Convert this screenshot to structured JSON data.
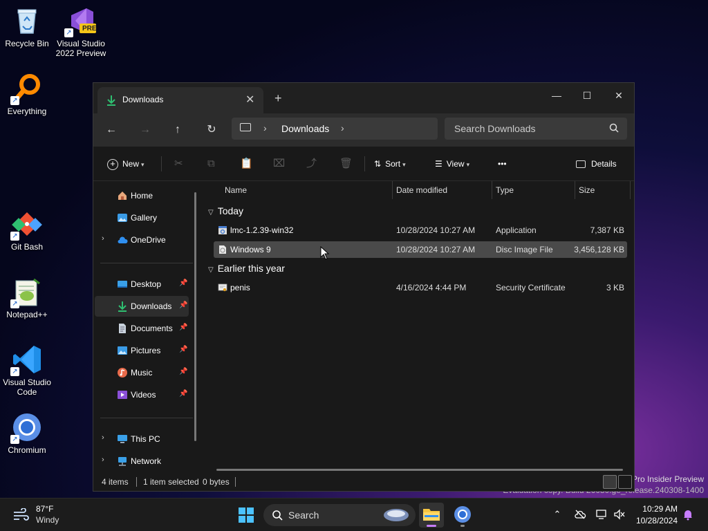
{
  "desktop": {
    "icons": [
      {
        "label": "Recycle Bin"
      },
      {
        "label": "Visual Studio 2022 Preview",
        "badge": "PRE"
      },
      {
        "label": "Everything"
      },
      {
        "label": "Git Bash"
      },
      {
        "label": "Notepad++"
      },
      {
        "label": "Visual Studio Code"
      },
      {
        "label": "Chromium"
      }
    ],
    "watermark_line1": "Pro Insider Preview",
    "watermark_line2": "Evaluation copy. Build 26080.ge_release.240308-1400"
  },
  "explorer": {
    "tab_title": "Downloads",
    "tab_close": "✕",
    "new_tab": "+",
    "window_controls": {
      "minimize": "—",
      "maximize": "☐",
      "close": "✕"
    },
    "nav": {
      "back": "←",
      "forward": "→",
      "up": "↑",
      "refresh": "↻"
    },
    "breadcrumb": {
      "separator": "›",
      "current": "Downloads"
    },
    "search_placeholder": "Search Downloads",
    "commands": {
      "new_label": "New",
      "sort_label": "Sort",
      "view_label": "View",
      "more_label": "•••",
      "details_label": "Details",
      "cut": "✂",
      "copy": "⧉",
      "paste": "📋",
      "rename": "⌧",
      "share": "⤴",
      "delete": "🗑"
    },
    "sidebar": {
      "items": [
        {
          "label": "Home",
          "pinned": false
        },
        {
          "label": "Gallery",
          "pinned": false
        },
        {
          "label": "OneDrive",
          "pinned": false,
          "expand": "›"
        },
        {
          "label": "Desktop",
          "pinned": true
        },
        {
          "label": "Downloads",
          "pinned": true
        },
        {
          "label": "Documents",
          "pinned": true
        },
        {
          "label": "Pictures",
          "pinned": true
        },
        {
          "label": "Music",
          "pinned": true
        },
        {
          "label": "Videos",
          "pinned": true
        },
        {
          "label": "This PC",
          "pinned": false,
          "expand": "›"
        },
        {
          "label": "Network",
          "pinned": false,
          "expand": "›"
        }
      ],
      "pin_glyph": "📌"
    },
    "columns": {
      "name": "Name",
      "date": "Date modified",
      "type": "Type",
      "size": "Size"
    },
    "groups": [
      {
        "label": "Today",
        "files": [
          {
            "name": "lmc-1.2.39-win32",
            "date": "10/28/2024 10:27 AM",
            "type": "Application",
            "size": "7,387 KB"
          },
          {
            "name": "Windows 9",
            "date": "10/28/2024 10:27 AM",
            "type": "Disc Image File",
            "size": "3,456,128 KB"
          }
        ]
      },
      {
        "label": "Earlier this year",
        "files": [
          {
            "name": "penis",
            "date": "4/16/2024 4:44 PM",
            "type": "Security Certificate",
            "size": "3 KB"
          }
        ]
      }
    ],
    "status": {
      "items_count": "4 items",
      "selected": "1 item selected",
      "selected_size": "0 bytes"
    }
  },
  "taskbar": {
    "weather_temp": "87°F",
    "weather_condition": "Windy",
    "search_placeholder": "Search",
    "clock_time": "10:29 AM",
    "clock_date": "10/28/2024",
    "tray": {
      "chevron": "⌃"
    }
  },
  "colors": {
    "accent_downloads": "#2fbf71",
    "selection": "#4a4a4a",
    "notification": "#c77dff"
  }
}
